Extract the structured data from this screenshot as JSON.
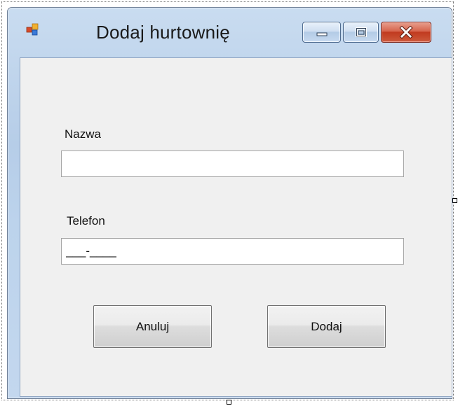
{
  "window": {
    "title": "Dodaj hurtownię"
  },
  "form": {
    "name_label": "Nazwa",
    "name_value": "",
    "phone_label": "Telefon",
    "phone_value": "___-____"
  },
  "buttons": {
    "cancel_label": "Anuluj",
    "add_label": "Dodaj"
  },
  "icons": {
    "app": "app-icon",
    "minimize": "minimize-icon",
    "maximize": "maximize-icon",
    "close": "close-icon"
  },
  "colors": {
    "close_button": "#c9452a",
    "client_background": "#f0f0f0",
    "frame": "#bcd3ec"
  }
}
